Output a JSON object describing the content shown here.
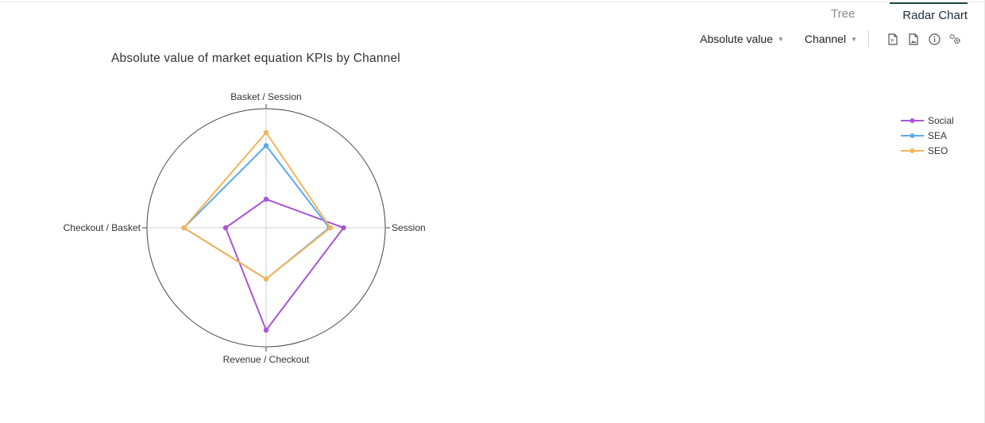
{
  "tabs": [
    {
      "label": "Tree",
      "active": false
    },
    {
      "label": "Radar Chart",
      "active": true
    }
  ],
  "toolbar": {
    "measure": "Absolute value",
    "dimension": "Channel",
    "icons": [
      "pdf-export-icon",
      "image-export-icon",
      "info-icon",
      "settings-icon"
    ]
  },
  "chart_data": {
    "type": "radar",
    "title": "Absolute value of market equation KPIs by Channel",
    "axes": [
      "Basket / Session",
      "Session",
      "Revenue / Checkout",
      "Checkout / Basket"
    ],
    "range": [
      0,
      1
    ],
    "legend_position": "top-right",
    "series": [
      {
        "name": "Social",
        "color": "#a855d6",
        "values": [
          0.24,
          0.65,
          0.86,
          0.34
        ]
      },
      {
        "name": "SEA",
        "color": "#5aaaf0",
        "values": [
          0.69,
          0.53,
          0.43,
          0.69
        ]
      },
      {
        "name": "SEO",
        "color": "#f2b457",
        "values": [
          0.8,
          0.54,
          0.43,
          0.69
        ]
      }
    ]
  }
}
